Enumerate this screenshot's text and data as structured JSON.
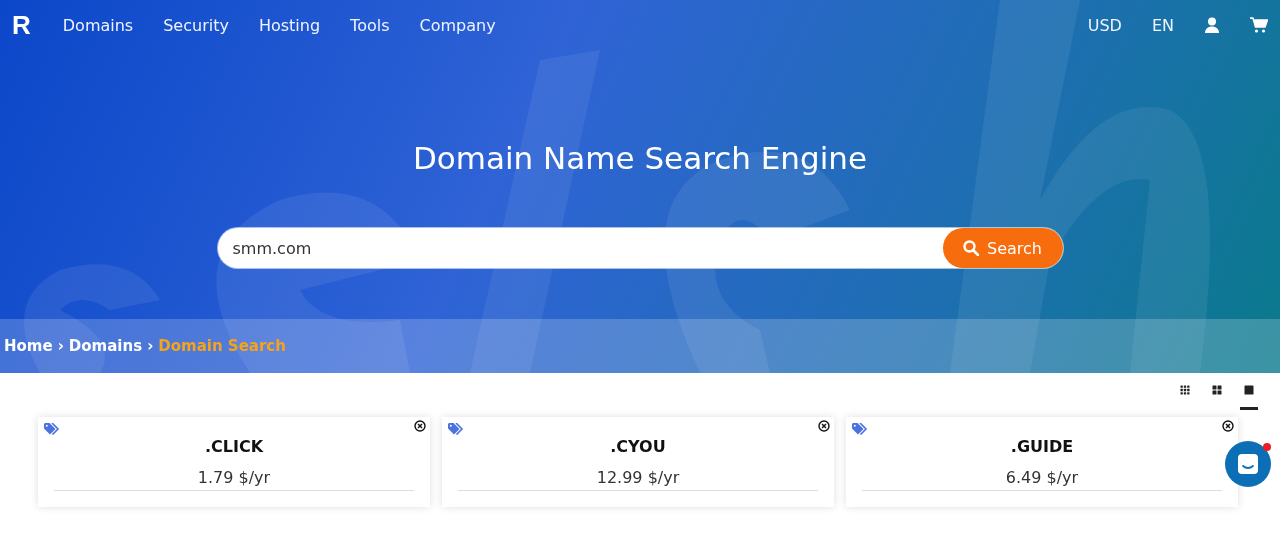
{
  "logo": "R",
  "nav": {
    "links": [
      "Domains",
      "Security",
      "Hosting",
      "Tools",
      "Company"
    ],
    "currency": "USD",
    "language": "EN"
  },
  "hero": {
    "title": "Domain Name Search Engine",
    "search": {
      "value": "smm.com",
      "button": "Search"
    }
  },
  "breadcrumb_separator": "›",
  "breadcrumb": [
    {
      "label": "Home",
      "current": false
    },
    {
      "label": "Domains",
      "current": false
    },
    {
      "label": "Domain Search",
      "current": true
    }
  ],
  "view_options": [
    {
      "kind": "small",
      "selected": false
    },
    {
      "kind": "medium",
      "selected": false
    },
    {
      "kind": "large",
      "selected": true
    }
  ],
  "cards": [
    {
      "name": ".CLICK",
      "price": "1.79 $/yr"
    },
    {
      "name": ".CYOU",
      "price": "12.99 $/yr"
    },
    {
      "name": ".GUIDE",
      "price": "6.49 $/yr"
    }
  ],
  "chat": {
    "unread": true
  }
}
